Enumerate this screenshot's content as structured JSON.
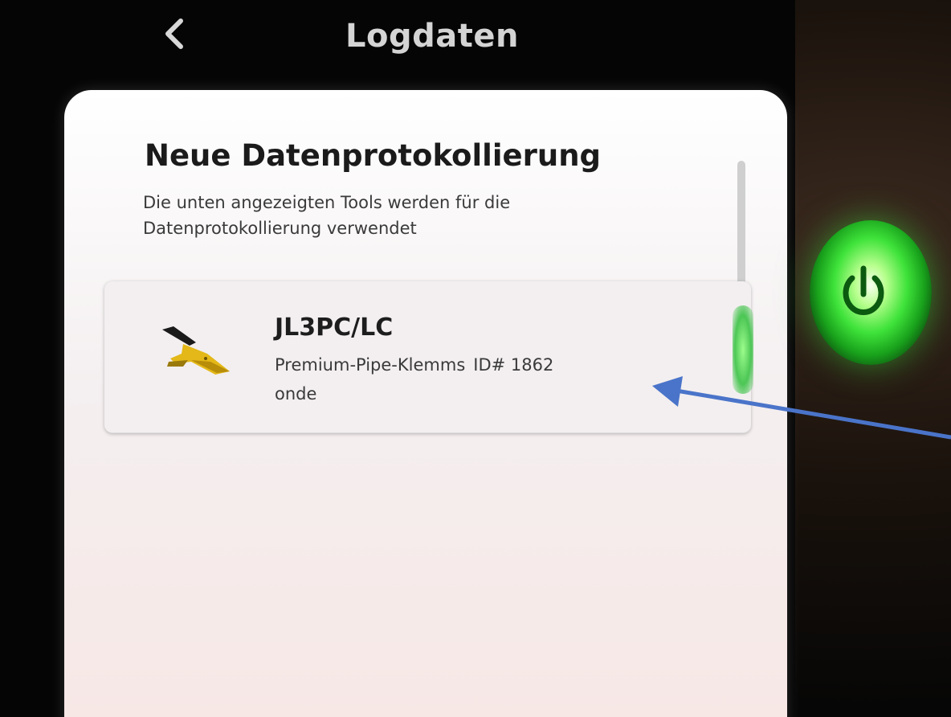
{
  "header": {
    "back_symbol": "<",
    "title": "Logdaten"
  },
  "page": {
    "heading": "Neue Datenprotokollierung",
    "description": "Die unten angezeigten Tools werden für die Datenprotokollierung verwendet"
  },
  "tool": {
    "name": "JL3PC/LC",
    "description": "Premium-Pipe-Klemms",
    "id_label": "ID# 1862",
    "description_cont": "onde",
    "icon": "clamp-icon"
  },
  "device": {
    "power_icon": "power-icon",
    "power_color": "#3fe33a"
  },
  "colors": {
    "arrow": "#4a74c9",
    "sheet": "#ffffff"
  }
}
